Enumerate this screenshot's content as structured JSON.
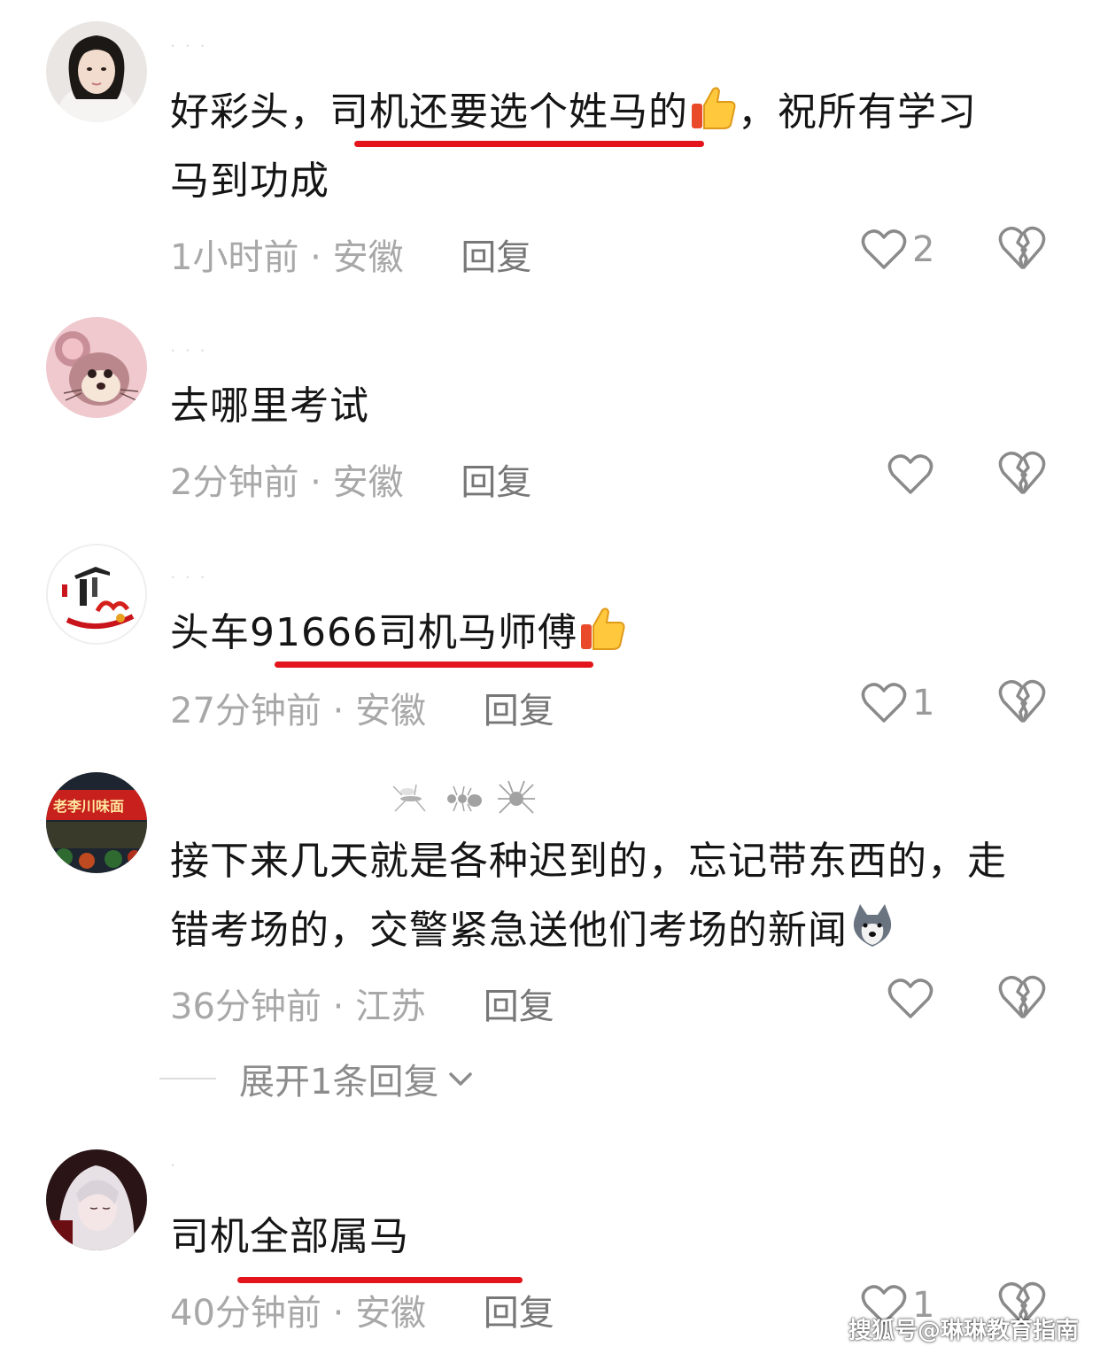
{
  "comments": [
    {
      "id": 1,
      "text_before": "好彩头，",
      "text_highlight": "司机还要选个姓马的",
      "text_after_line1": "，祝所有学习",
      "text_line2": "马到功成",
      "emoji": "thumbs-up",
      "time": "1小时前",
      "location": "安徽",
      "reply": "回复",
      "likes": "2"
    },
    {
      "id": 2,
      "text": "去哪里考试",
      "time": "2分钟前",
      "location": "安徽",
      "reply": "回复",
      "likes": ""
    },
    {
      "id": 3,
      "text_before": "头车",
      "text_highlight": "91666司机马师傅",
      "emoji": "thumbs-up",
      "time": "27分钟前",
      "location": "安徽",
      "reply": "回复",
      "likes": "1"
    },
    {
      "id": 4,
      "text_line1": "接下来几天就是各种迟到的，忘记带东西的，走",
      "text_line2": "错考场的，交警紧急送他们考场的新闻",
      "emoji": "husky",
      "time": "36分钟前",
      "location": "江苏",
      "reply": "回复",
      "likes": "",
      "expand_label": "展开1条回复"
    },
    {
      "id": 5,
      "text": "司机全部属马",
      "time": "40分钟前",
      "location": "安徽",
      "reply": "回复",
      "likes": "1"
    }
  ],
  "avatar_texts": {
    "shop_sign": "老李川味面"
  },
  "watermark": "搜狐号@琳琳教育指南",
  "colors": {
    "highlight": "#e3141b",
    "meta": "#a8a8a8",
    "text": "#151515"
  }
}
